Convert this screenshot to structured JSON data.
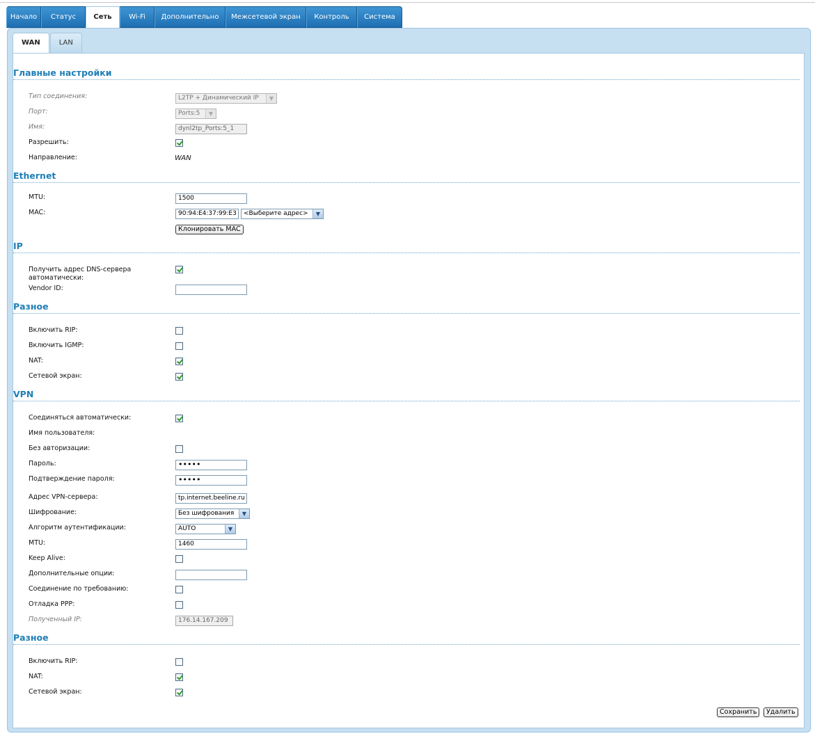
{
  "topnav": [
    {
      "label": "Начало",
      "w": 50
    },
    {
      "label": "Статус",
      "w": 64
    },
    {
      "label": "Сеть",
      "w": 49,
      "active": true
    },
    {
      "label": "Wi-Fi",
      "w": 50
    },
    {
      "label": "Дополнительно",
      "w": 102
    },
    {
      "label": "Межсетевой экран",
      "w": 116
    },
    {
      "label": "Контроль",
      "w": 73
    },
    {
      "label": "Система",
      "w": 65
    }
  ],
  "subnav": [
    {
      "label": "WAN",
      "active": true
    },
    {
      "label": "LAN"
    }
  ],
  "main": {
    "title": "Главные настройки",
    "conn_type_label": "Тип соединения:",
    "conn_type_value": "L2TP + Динамический IP",
    "port_label": "Порт:",
    "port_value": "Ports:5",
    "name_label": "Имя:",
    "name_value": "dynl2tp_Ports:5_1",
    "enable_label": "Разрешить:",
    "direction_label": "Направление:",
    "direction_value": "WAN"
  },
  "ethernet": {
    "title": "Ethernet",
    "mtu_label": "MTU:",
    "mtu_value": "1500",
    "mac_label": "MAC:",
    "mac_value": "90:94:E4:37:99:E3",
    "mac_select": "<Выберите адрес>",
    "clone_button": "Клонировать MAC"
  },
  "ip": {
    "title": "IP",
    "dns_auto_label": "Получить адрес DNS-сервера автоматически:",
    "vendor_label": "Vendor ID:",
    "vendor_value": ""
  },
  "misc1": {
    "title": "Разное",
    "rip_label": "Включить RIP:",
    "igmp_label": "Включить IGMP:",
    "nat_label": "NAT:",
    "fw_label": "Сетевой экран:"
  },
  "vpn": {
    "title": "VPN",
    "auto_label": "Соединяться автоматически:",
    "user_label": "Имя пользователя:",
    "noauth_label": "Без авторизации:",
    "pass_label": "Пароль:",
    "pass_value": "•••••",
    "pass2_label": "Подтверждение пароля:",
    "pass2_value": "•••••",
    "server_label": "Адрес VPN-сервера:",
    "server_value": "tp.internet.beeline.ru",
    "enc_label": "Шифрование:",
    "enc_value": "Без шифрования",
    "auth_label": "Алгоритм аутентификации:",
    "auth_value": "AUTO",
    "mtu_label": "MTU:",
    "mtu_value": "1460",
    "keepalive_label": "Keep Alive:",
    "opts_label": "Дополнительные опции:",
    "opts_value": "",
    "ondemand_label": "Соединение по требованию:",
    "debug_label": "Отладка PPP:",
    "gotip_label": "Полученный IP:",
    "gotip_value": "176.14.167.209"
  },
  "misc2": {
    "title": "Разное",
    "rip_label": "Включить RIP:",
    "nat_label": "NAT:",
    "fw_label": "Сетевой экран:"
  },
  "actions": {
    "save": "Сохранить",
    "delete": "Удалить"
  },
  "colors": {
    "tab_blue": "#2a82c6",
    "panel": "#c6dff1",
    "section_title": "#1f7fb6",
    "check": "#2a9a2a"
  }
}
